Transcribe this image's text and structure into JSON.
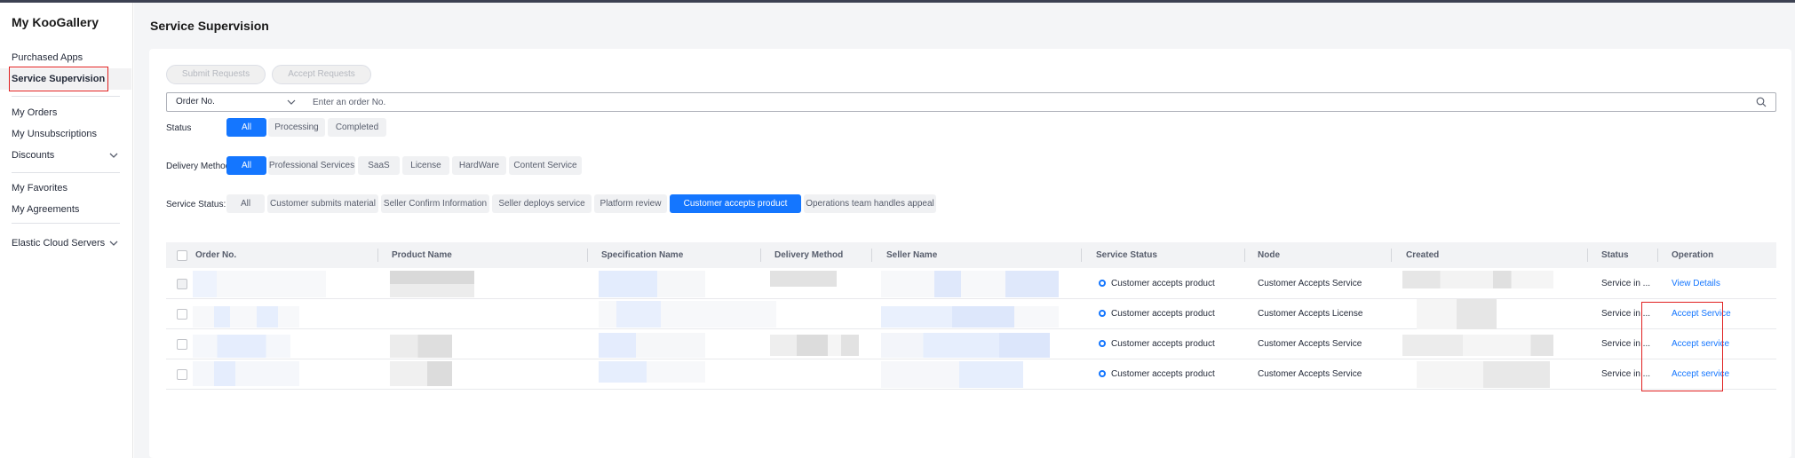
{
  "sidebar": {
    "brand": "My KooGallery",
    "items": [
      {
        "label": "Purchased Apps"
      },
      {
        "label": "Service Supervision"
      },
      {
        "label": "My Orders"
      },
      {
        "label": "My Unsubscriptions"
      },
      {
        "label": "Discounts"
      },
      {
        "label": "My Favorites"
      },
      {
        "label": "My Agreements"
      },
      {
        "label": "Elastic Cloud Servers"
      }
    ]
  },
  "page": {
    "title": "Service Supervision"
  },
  "actions": {
    "submit": "Submit Requests",
    "accept": "Accept Requests"
  },
  "search": {
    "field": "Order No.",
    "placeholder": "Enter an order No."
  },
  "filters": {
    "status": {
      "label": "Status",
      "options": [
        "All",
        "Processing",
        "Completed"
      ],
      "selected": "All"
    },
    "delivery": {
      "label": "Delivery Method",
      "options": [
        "All",
        "Professional Services",
        "SaaS",
        "License",
        "HardWare",
        "Content Service"
      ],
      "selected": "All"
    },
    "service_status": {
      "label": "Service Status:",
      "options": [
        "All",
        "Customer submits material",
        "Seller Confirm Information",
        "Seller deploys service",
        "Platform review",
        "Customer accepts product",
        "Operations team handles appeal"
      ],
      "selected": "Customer accepts product"
    }
  },
  "table": {
    "columns": [
      "Order No.",
      "Product Name",
      "Specification Name",
      "Delivery Method",
      "Seller Name",
      "Service Status",
      "Node",
      "Created",
      "Status",
      "Operation"
    ],
    "rows": [
      {
        "service_status": "Customer accepts product",
        "node": "Customer Accepts Service",
        "status": "Service in ...",
        "operation": "View Details"
      },
      {
        "service_status": "Customer accepts product",
        "node": "Customer Accepts License",
        "status": "Service in ...",
        "operation": "Accept Service"
      },
      {
        "service_status": "Customer accepts product",
        "node": "Customer Accepts Service",
        "status": "Service in ...",
        "operation": "Accept service"
      },
      {
        "service_status": "Customer accepts product",
        "node": "Customer Accepts Service",
        "status": "Service in ...",
        "operation": "Accept service"
      }
    ]
  },
  "colors": {
    "accent": "#1476ff",
    "highlight": "#e02020"
  },
  "icons": [
    "chevron-down-icon",
    "search-icon",
    "checkbox-icon",
    "status-dot-icon"
  ]
}
